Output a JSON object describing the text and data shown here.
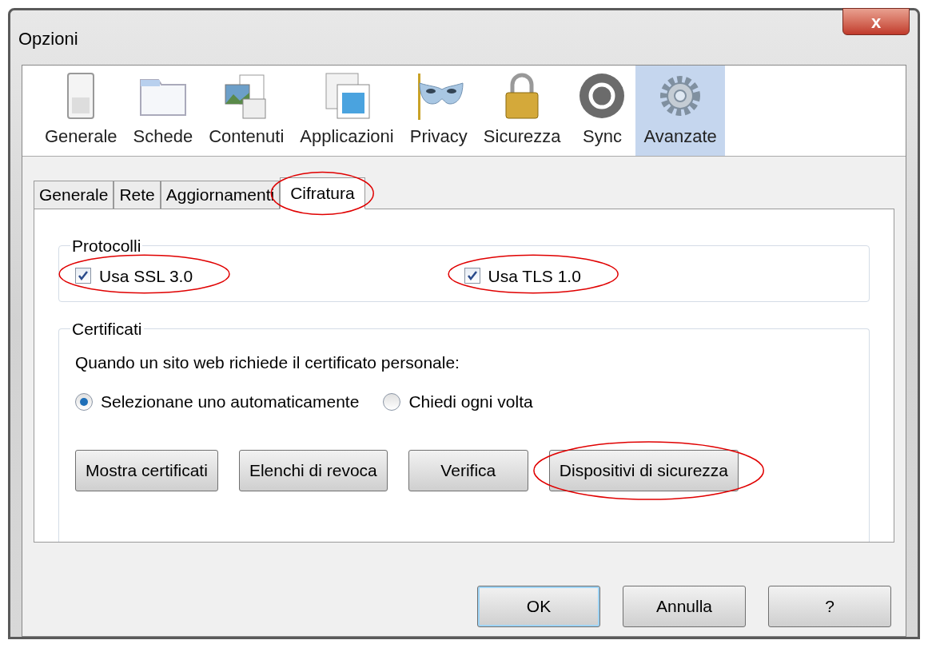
{
  "window": {
    "title": "Opzioni",
    "close_label": "x"
  },
  "categories": [
    {
      "label": "Generale",
      "kind": "switch",
      "selected": false
    },
    {
      "label": "Schede",
      "kind": "folder",
      "selected": false
    },
    {
      "label": "Contenuti",
      "kind": "media",
      "selected": false
    },
    {
      "label": "Applicazioni",
      "kind": "apps",
      "selected": false
    },
    {
      "label": "Privacy",
      "kind": "mask",
      "selected": false
    },
    {
      "label": "Sicurezza",
      "kind": "lock",
      "selected": false
    },
    {
      "label": "Sync",
      "kind": "sync",
      "selected": false
    },
    {
      "label": "Avanzate",
      "kind": "gear",
      "selected": true
    }
  ],
  "tabs": [
    {
      "label": "Generale",
      "selected": false,
      "circled": false
    },
    {
      "label": "Rete",
      "selected": false,
      "circled": false
    },
    {
      "label": "Aggiornamenti",
      "selected": false,
      "circled": false
    },
    {
      "label": "Cifratura",
      "selected": true,
      "circled": true
    }
  ],
  "protocols": {
    "title": "Protocolli",
    "options": [
      {
        "label": "Usa SSL 3.0",
        "checked": true,
        "circled": true
      },
      {
        "label": "Usa TLS 1.0",
        "checked": true,
        "circled": true
      }
    ]
  },
  "certificates": {
    "title": "Certificati",
    "prompt": "Quando un sito web richiede il certificato personale:",
    "choices": [
      {
        "label": "Selezionane uno automaticamente",
        "selected": true
      },
      {
        "label": "Chiedi ogni volta",
        "selected": false
      }
    ],
    "buttons": [
      {
        "label": "Mostra certificati",
        "circled": false
      },
      {
        "label": "Elenchi di revoca",
        "circled": false
      },
      {
        "label": "Verifica",
        "circled": false
      },
      {
        "label": "Dispositivi di sicurezza",
        "circled": true
      }
    ]
  },
  "footer_buttons": [
    {
      "label": "OK",
      "default": true
    },
    {
      "label": "Annulla",
      "default": false
    },
    {
      "label": "?",
      "default": false
    }
  ]
}
